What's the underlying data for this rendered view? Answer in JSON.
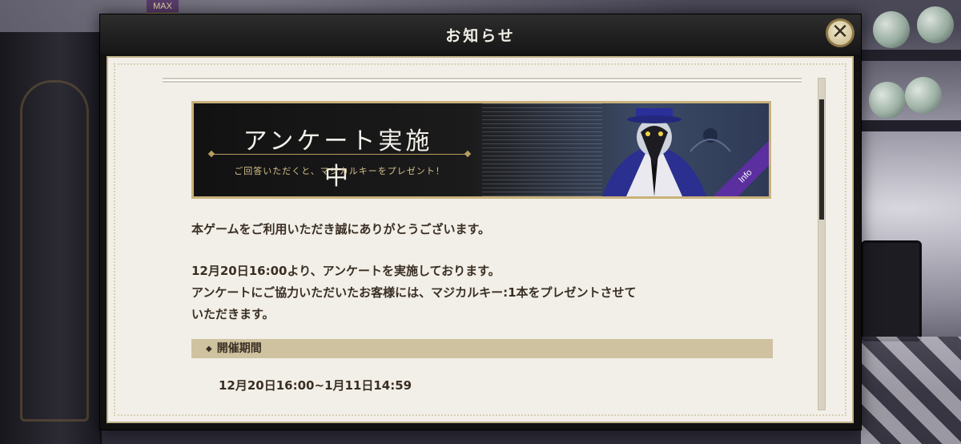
{
  "hud": {
    "max_badge": "MAX"
  },
  "modal": {
    "title": "お知らせ",
    "close_label": "✕"
  },
  "banner": {
    "title": "アンケート実施中",
    "subtitle": "ご回答いただくと、マジカルキーをプレゼント！",
    "ribbon": "Info"
  },
  "notice": {
    "greeting": "本ゲームをご利用いただき誠にありがとうございます。",
    "lines": [
      "12月20日16:00より、アンケートを実施しております。",
      "アンケートにご協力いただいたお客様には、マジカルキー:1本をプレゼントさせて",
      "いただきます。"
    ],
    "section_title": "開催期間",
    "period": "12月20日16:00~1月11日14:59"
  },
  "colors": {
    "accent_gold": "#c9b27c",
    "ribbon_purple": "#5b2fa0",
    "text_brown": "#3a2f24"
  },
  "scroll": {
    "position_fraction": 0.0
  }
}
